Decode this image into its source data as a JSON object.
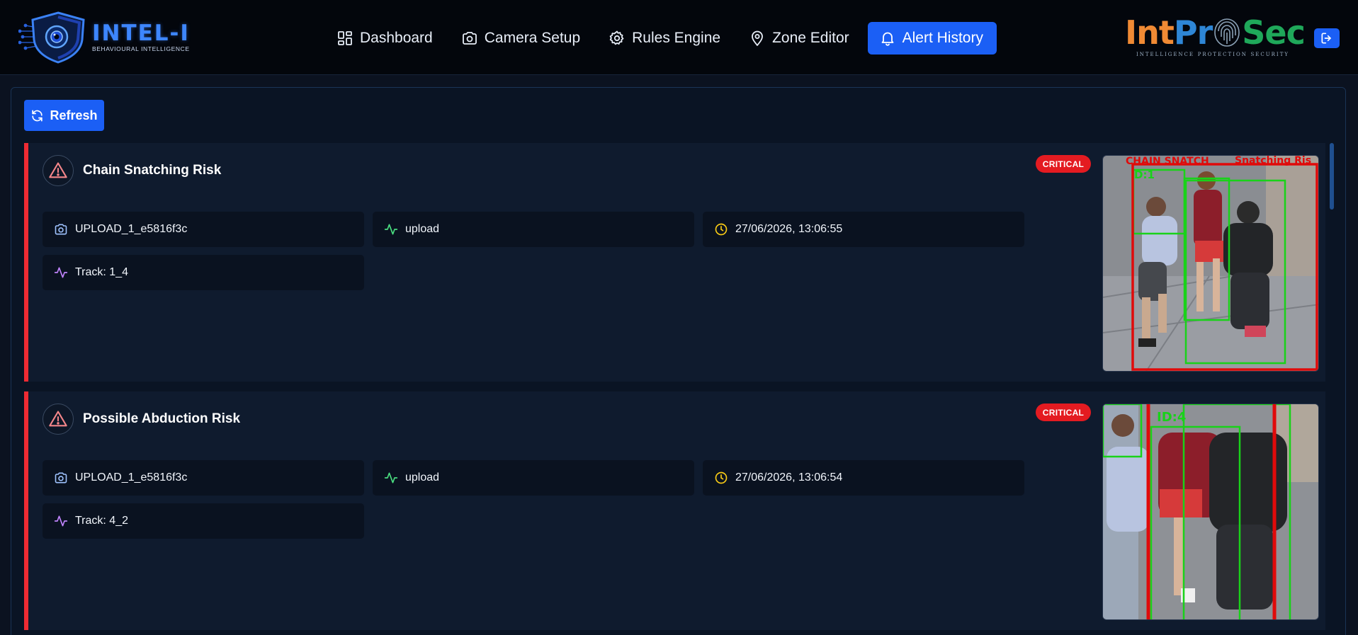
{
  "brand": {
    "name": "INTEL-I",
    "tagline": "BEHAVIOURAL INTELLIGENCE"
  },
  "nav": {
    "items": [
      {
        "label": "Dashboard",
        "icon": "grid-icon",
        "active": false
      },
      {
        "label": "Camera Setup",
        "icon": "camera-icon",
        "active": false
      },
      {
        "label": "Rules Engine",
        "icon": "gear-icon",
        "active": false
      },
      {
        "label": "Zone Editor",
        "icon": "map-pin-icon",
        "active": false
      },
      {
        "label": "Alert History",
        "icon": "bell-icon",
        "active": true
      }
    ]
  },
  "partner": {
    "word_int": "Int",
    "word_pro": "Pr",
    "word_sec": "Sec",
    "tag_1": "INTELLIGENCE",
    "tag_2": "PROTECTION",
    "tag_3": "SECURITY"
  },
  "toolbar": {
    "refresh_label": "Refresh"
  },
  "alerts": [
    {
      "title": "Chain Snatching Risk",
      "severity": "CRITICAL",
      "camera": "UPLOAD_1_e5816f3c",
      "source": "upload",
      "timestamp": "27/06/2026, 13:06:55",
      "track": "Track: 1_4",
      "thumb_overlay_1": "CHAIN SNATCH",
      "thumb_overlay_2": "Snatching Ris",
      "thumb_id": "D:1"
    },
    {
      "title": "Possible Abduction Risk",
      "severity": "CRITICAL",
      "camera": "UPLOAD_1_e5816f3c",
      "source": "upload",
      "timestamp": "27/06/2026, 13:06:54",
      "track": "Track: 4_2",
      "thumb_id": "ID:4"
    }
  ],
  "colors": {
    "accent": "#1b5ff5",
    "critical": "#e41b21",
    "card_border": "#ef2b33",
    "camera_icon": "#9fc3ff",
    "activity_icon": "#4ade80",
    "clock_icon": "#facc15",
    "track_icon": "#c084fc"
  }
}
